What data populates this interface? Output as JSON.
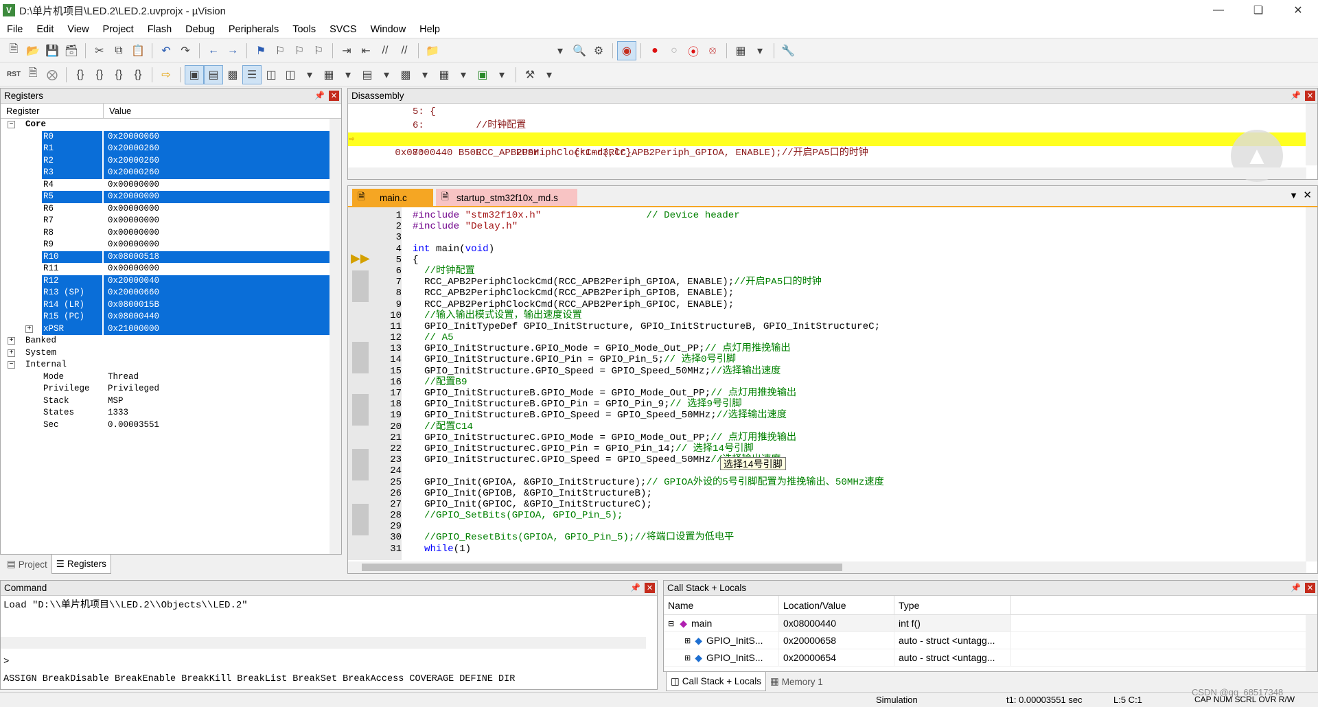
{
  "window": {
    "title": "D:\\单片机项目\\LED.2\\LED.2.uvprojx - µVision",
    "app_icon": "V"
  },
  "menu": [
    "File",
    "Edit",
    "View",
    "Project",
    "Flash",
    "Debug",
    "Peripherals",
    "Tools",
    "SVCS",
    "Window",
    "Help"
  ],
  "registers": {
    "title": "Registers",
    "col_register": "Register",
    "col_value": "Value",
    "groups": {
      "core": "Core",
      "banked": "Banked",
      "system": "System",
      "internal": "Internal"
    },
    "core": [
      {
        "name": "R0",
        "value": "0x20000060"
      },
      {
        "name": "R1",
        "value": "0x20000260"
      },
      {
        "name": "R2",
        "value": "0x20000260"
      },
      {
        "name": "R3",
        "value": "0x20000260"
      },
      {
        "name": "R4",
        "value": "0x00000000"
      },
      {
        "name": "R5",
        "value": "0x20000000"
      },
      {
        "name": "R6",
        "value": "0x00000000"
      },
      {
        "name": "R7",
        "value": "0x00000000"
      },
      {
        "name": "R8",
        "value": "0x00000000"
      },
      {
        "name": "R9",
        "value": "0x00000000"
      },
      {
        "name": "R10",
        "value": "0x08000518"
      },
      {
        "name": "R11",
        "value": "0x00000000"
      },
      {
        "name": "R12",
        "value": "0x20000040"
      },
      {
        "name": "R13 (SP)",
        "value": "0x20000660"
      },
      {
        "name": "R14 (LR)",
        "value": "0x0800015B"
      },
      {
        "name": "R15 (PC)",
        "value": "0x08000440"
      },
      {
        "name": "xPSR",
        "value": "0x21000000"
      }
    ],
    "internal": [
      {
        "name": "Mode",
        "value": "Thread"
      },
      {
        "name": "Privilege",
        "value": "Privileged"
      },
      {
        "name": "Stack",
        "value": "MSP"
      },
      {
        "name": "States",
        "value": "1333"
      },
      {
        "name": "Sec",
        "value": "0.00003551"
      }
    ]
  },
  "left_tabs": {
    "project": "Project",
    "registers": "Registers"
  },
  "disassembly": {
    "title": "Disassembly",
    "lines": [
      {
        "text": "          5: {"
      },
      {
        "text": "          6:         //时钟配置"
      },
      {
        "text": "0x08000440 B50E      PUSH      {r1-r3,lr}"
      },
      {
        "text": "          7:         RCC_APB2PeriphClockCmd(RCC_APB2Periph_GPIOA, ENABLE);//开启PA5口的时钟"
      }
    ]
  },
  "editor": {
    "tab_main": "main.c",
    "tab_startup": "startup_stm32f10x_md.s",
    "tooltip": "选择14号引脚",
    "lines": [
      "#include \"stm32f10x.h\"                  // Device header",
      "#include \"Delay.h\"",
      "",
      "int main(void)",
      "{",
      "  //时钟配置",
      "  RCC_APB2PeriphClockCmd(RCC_APB2Periph_GPIOA, ENABLE);//开启PA5口的时钟",
      "  RCC_APB2PeriphClockCmd(RCC_APB2Periph_GPIOB, ENABLE);",
      "  RCC_APB2PeriphClockCmd(RCC_APB2Periph_GPIOC, ENABLE);",
      "  //输入输出模式设置，输出速度设置",
      "  GPIO_InitTypeDef GPIO_InitStructure, GPIO_InitStructureB, GPIO_InitStructureC;",
      "  // A5",
      "  GPIO_InitStructure.GPIO_Mode = GPIO_Mode_Out_PP;// 点灯用推挽输出",
      "  GPIO_InitStructure.GPIO_Pin = GPIO_Pin_5;// 选择0号引脚",
      "  GPIO_InitStructure.GPIO_Speed = GPIO_Speed_50MHz;//选择输出速度",
      "  //配置B9",
      "  GPIO_InitStructureB.GPIO_Mode = GPIO_Mode_Out_PP;// 点灯用推挽输出",
      "  GPIO_InitStructureB.GPIO_Pin = GPIO_Pin_9;// 选择9号引脚",
      "  GPIO_InitStructureB.GPIO_Speed = GPIO_Speed_50MHz;//选择输出速度",
      "  //配置C14",
      "  GPIO_InitStructureC.GPIO_Mode = GPIO_Mode_Out_PP;// 点灯用推挽输出",
      "  GPIO_InitStructureC.GPIO_Pin = GPIO_Pin_14;// 选择14号引脚",
      "  GPIO_InitStructureC.GPIO_Speed = GPIO_Speed_50MHz//选择输出速度",
      "",
      "  GPIO_Init(GPIOA, &GPIO_InitStructure);// GPIOA外设的5号引脚配置为推挽输出、50MHz速度",
      "  GPIO_Init(GPIOB, &GPIO_InitStructureB);",
      "  GPIO_Init(GPIOC, &GPIO_InitStructureC);",
      "  //GPIO_SetBits(GPIOA, GPIO_Pin_5);",
      "",
      "  //GPIO_ResetBits(GPIOA, GPIO_Pin_5);//将端口设置为低电平",
      "  while(1)"
    ]
  },
  "command": {
    "title": "Command",
    "output": "Load \"D:\\\\单片机项目\\\\LED.2\\\\Objects\\\\LED.2\"",
    "prompt": ">",
    "keywords": "ASSIGN BreakDisable BreakEnable BreakKill BreakList BreakSet BreakAccess COVERAGE DEFINE DIR"
  },
  "callstack": {
    "title": "Call Stack + Locals",
    "col_name": "Name",
    "col_location": "Location/Value",
    "col_type": "Type",
    "rows": [
      {
        "name": "main",
        "location": "0x08000440",
        "type": "int f()"
      },
      {
        "name": "GPIO_InitS...",
        "location": "0x20000658",
        "type": "auto - struct <untagg..."
      },
      {
        "name": "GPIO_InitS...",
        "location": "0x20000654",
        "type": "auto - struct <untagg..."
      }
    ],
    "tab_callstack": "Call Stack + Locals",
    "tab_memory": "Memory 1"
  },
  "status": {
    "mode": "Simulation",
    "t1": "t1: 0.00003551 sec",
    "position": "L:5 C:1",
    "keys": "CAP  NUM  SCRL  OVR  R/W",
    "watermark": "CSDN @qq_68517348"
  },
  "colors": {
    "selection": "#0a6ed8",
    "current_line": "#ffff20",
    "tab_active": "#f5a623"
  }
}
